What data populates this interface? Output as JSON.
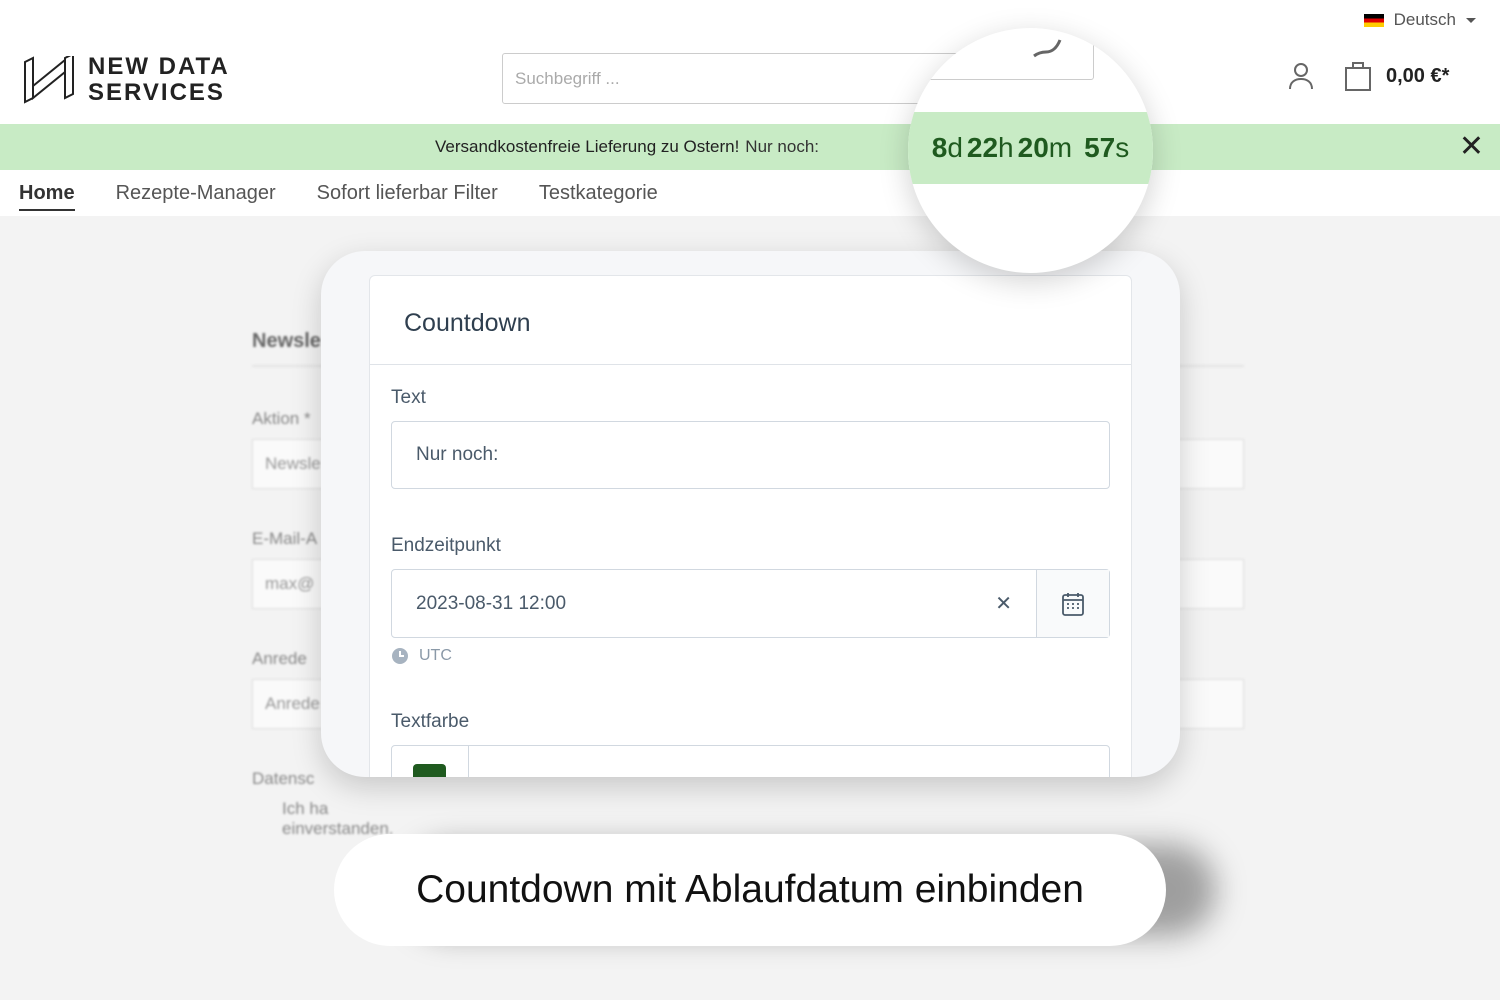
{
  "header": {
    "language": "Deutsch",
    "logo_line1": "NEW DATA",
    "logo_line2": "SERVICES",
    "search_placeholder": "Suchbegriff ...",
    "cart_total": "0,00 €*"
  },
  "banner": {
    "text": "Versandkostenfreie Lieferung zu Ostern!",
    "countdown_prefix": "Nur noch:",
    "countdown": {
      "days": "8",
      "days_unit": "d",
      "hours": "22",
      "hours_unit": "h",
      "minutes": "20",
      "minutes_unit": "m",
      "seconds": "57",
      "seconds_unit": "s"
    }
  },
  "nav": [
    "Home",
    "Rezepte-Manager",
    "Sofort lieferbar Filter",
    "Testkategorie"
  ],
  "background_form": {
    "heading": "Newsle",
    "labels": [
      "Aktion *",
      "E-Mail-A",
      "Anrede",
      "Datensc"
    ],
    "values": [
      "Newsle",
      "max@",
      "Anrede"
    ],
    "checkbox": "Ich ha",
    "checkbox_line2": "einverstanden."
  },
  "card": {
    "title": "Countdown",
    "text_label": "Text",
    "text_value": "Nur noch:",
    "end_label": "Endzeitpunkt",
    "end_value": "2023-08-31 12:00",
    "timezone": "UTC",
    "color_label": "Textfarbe",
    "color_value": "#1f5a1f"
  },
  "caption": "Countdown mit Ablaufdatum einbinden",
  "colors": {
    "banner": "#c8ebc5",
    "countdown": "#1f5a1f"
  }
}
